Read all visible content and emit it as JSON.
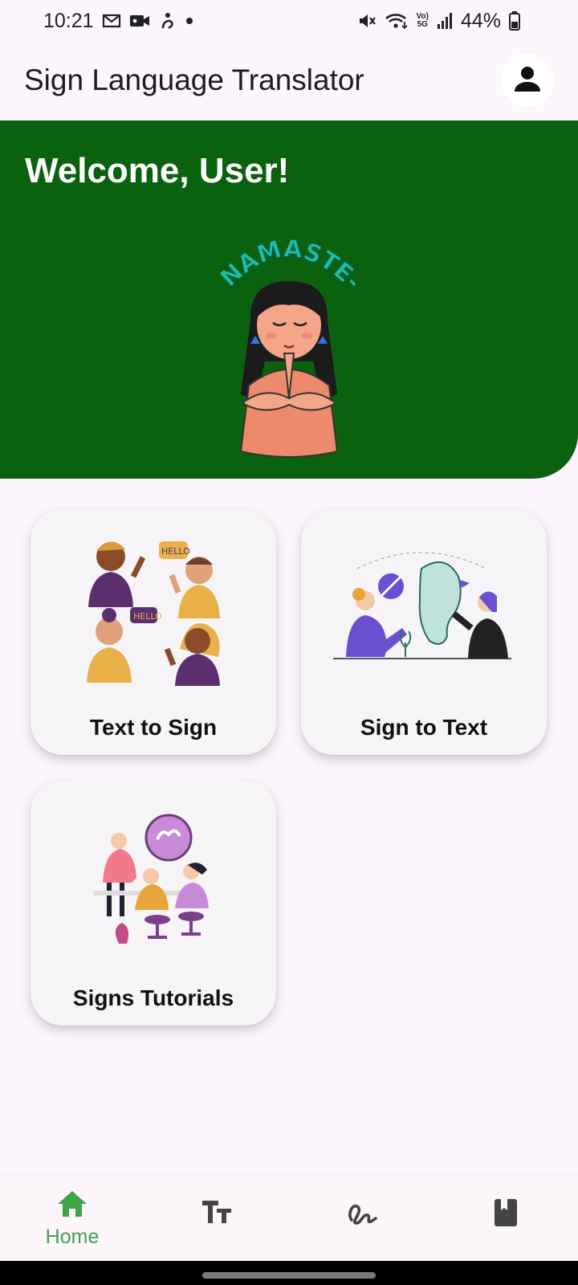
{
  "status_bar": {
    "time": "10:21",
    "left_icons": [
      "gmail-icon",
      "video-camera-icon",
      "accessibility-icon",
      "dot-icon"
    ],
    "right_icons": [
      "mute-icon",
      "wifi-icon",
      "volte-5g-icon",
      "signal-icon",
      "battery-icon"
    ],
    "network_label_top": "Vo)",
    "network_label_bottom": "5G",
    "battery_percent": "44%"
  },
  "app_bar": {
    "title": "Sign Language Translator",
    "profile_icon": "person-icon"
  },
  "banner": {
    "welcome": "Welcome, User!",
    "illustration_text": "NAMASTE-JI",
    "color": "#0a620f"
  },
  "cards": [
    {
      "label": "Text to Sign",
      "illustration": "people-waving-hello-illustration",
      "bubble_1": "HELLO",
      "bubble_2": "HELLO"
    },
    {
      "label": "Sign to Text",
      "illustration": "sign-conversation-illustration"
    },
    {
      "label": "Signs Tutorials",
      "illustration": "sign-class-illustration"
    }
  ],
  "bottom_nav": {
    "active_color": "#3fa34a",
    "items": [
      {
        "label": "Home",
        "icon": "home-icon",
        "active": true
      },
      {
        "label": "",
        "icon": "text-size-icon",
        "active": false
      },
      {
        "label": "",
        "icon": "signature-icon",
        "active": false
      },
      {
        "label": "",
        "icon": "book-icon",
        "active": false
      }
    ]
  }
}
